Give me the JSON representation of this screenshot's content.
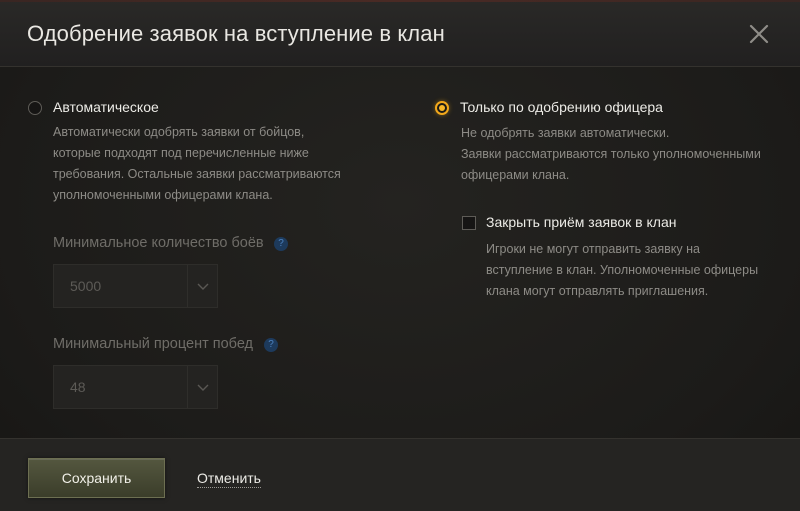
{
  "dialog": {
    "title": "Одобрение заявок на вступление в клан",
    "close_icon": "close-icon"
  },
  "auto_option": {
    "label": "Автоматическое",
    "selected": false,
    "description": [
      "Автоматически одобрять заявки от бойцов,",
      "которые подходят под перечисленные ниже",
      "требования. Остальные заявки рассматриваются",
      "уполномоченными офицерами клана."
    ],
    "min_battles": {
      "label": "Минимальное количество боёв",
      "help_icon": "question-icon",
      "help_glyph": "?",
      "value": "5000"
    },
    "min_winrate": {
      "label": "Минимальный процент побед",
      "help_icon": "question-icon",
      "help_glyph": "?",
      "value": "48"
    }
  },
  "officer_option": {
    "label": "Только по одобрению офицера",
    "selected": true,
    "description": [
      "Не одобрять заявки автоматически.",
      "Заявки рассматриваются только уполномоченными",
      "офицерами клана."
    ],
    "close_applications": {
      "label": "Закрыть приём заявок в клан",
      "checked": false,
      "description": [
        "Игроки не могут отправить заявку на",
        "вступление в клан. Уполномоченные офицеры",
        "клана могут отправлять приглашения."
      ]
    }
  },
  "footer": {
    "save_label": "Сохранить",
    "cancel_label": "Отменить"
  },
  "colors": {
    "accent": "#f2a81b",
    "help_blue": "#4c82c0",
    "save_button": "#4a4d36"
  }
}
